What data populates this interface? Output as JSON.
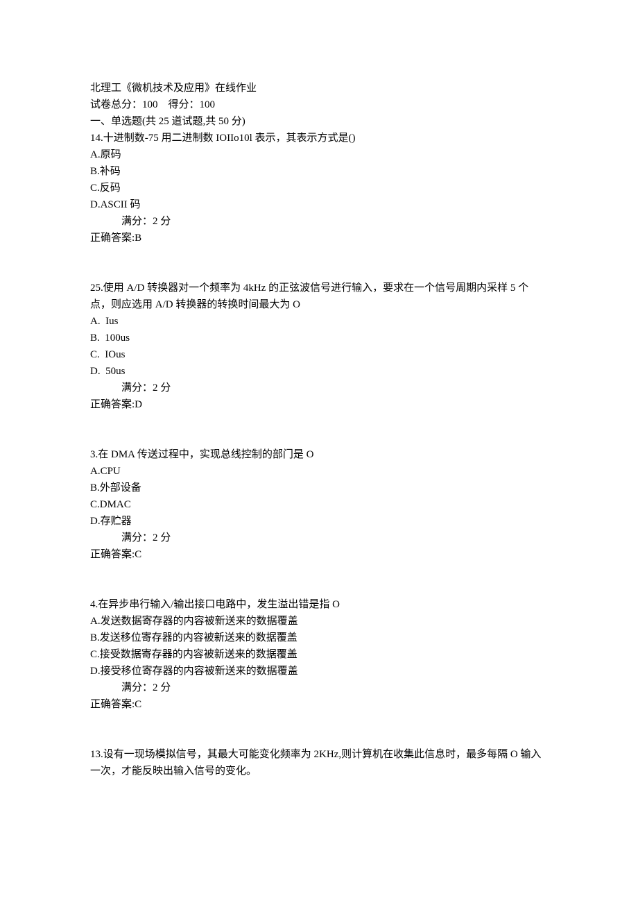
{
  "header": {
    "title": "北理工《微机技术及应用》在线作业",
    "score_line": "试卷总分：100    得分：100",
    "section": "一、单选题(共 25 道试题,共 50 分)"
  },
  "questions": [
    {
      "stem": "14.十进制数-75 用二进制数 IOIIo10l 表示，其表示方式是()",
      "options": [
        "A.原码",
        "B.补码",
        "C.反码",
        "D.ASCII 码"
      ],
      "full_marks": "满分：2 分",
      "answer": "正确答案:B"
    },
    {
      "stem": "25.使用 A/D 转换器对一个频率为 4kHz 的正弦波信号进行输入，要求在一个信号周期内采样 5 个点，则应选用 A/D 转换器的转换时间最大为 O",
      "options": [
        "A.  Ius",
        "B.  100us",
        "C.  IOus",
        "D.  50us"
      ],
      "full_marks": "满分：2 分",
      "answer": "正确答案:D"
    },
    {
      "stem": "3.在 DMA 传送过程中，实现总线控制的部门是 O",
      "options": [
        "A.CPU",
        "B.外部设备",
        "C.DMAC",
        "D.存贮器"
      ],
      "full_marks": "满分：2 分",
      "answer": "正确答案:C"
    },
    {
      "stem": "4.在异步串行输入/输出接口电路中，发生溢出错是指 O",
      "options": [
        "A.发送数据寄存器的内容被新送来的数据覆盖",
        "B.发送移位寄存器的内容被新送来的数据覆盖",
        "C.接受数据寄存器的内容被新送来的数据覆盖",
        "D.接受移位寄存器的内容被新送来的数据覆盖"
      ],
      "full_marks": "满分：2 分",
      "answer": "正确答案:C"
    },
    {
      "stem": "13.设有一现场模拟信号，其最大可能变化频率为 2KHz,则计算机在收集此信息时，最多每隔 O 输入一次，才能反映出输入信号的变化。",
      "options": [],
      "full_marks": "",
      "answer": ""
    }
  ]
}
